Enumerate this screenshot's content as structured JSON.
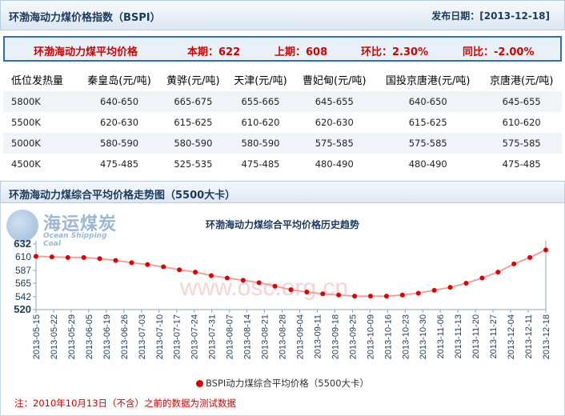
{
  "header": {
    "title": "环渤海动力煤价格指数（BSPI）",
    "date_label": "发布日期：[2013-12-18]"
  },
  "summary": {
    "label": "环渤海动力煤平均价格",
    "current": "本期：622",
    "previous": "上期：608",
    "mom": "环比：2.30%",
    "yoy": "同比：-2.00%"
  },
  "table": {
    "headers": [
      "低位发热量",
      "秦皇岛(元/吨)",
      "黄骅(元/吨)",
      "天津(元/吨)",
      "曹妃甸(元/吨)",
      "国投京唐港(元/吨)",
      "京唐港(元/吨)"
    ],
    "rows": [
      [
        "5800K",
        "640-650",
        "665-675",
        "655-665",
        "645-655",
        "640-650",
        "645-655"
      ],
      [
        "5500K",
        "620-630",
        "615-625",
        "610-620",
        "620-630",
        "615-625",
        "610-620"
      ],
      [
        "5000K",
        "580-590",
        "580-590",
        "580-590",
        "575-585",
        "575-585",
        "575-585"
      ],
      [
        "4500K",
        "475-485",
        "525-535",
        "475-485",
        "480-490",
        "480-490",
        "475-485"
      ]
    ]
  },
  "chart_section": {
    "title": "环渤海动力煤综合平均价格走势图（5500大卡）",
    "logo_cn": "海运煤炭",
    "logo_en": "Ocean Shipping Coal",
    "watermark": "www.osc.org.cn",
    "note": "注：2010年10月13日（不含）之前的数据为测试数据"
  },
  "chart_data": {
    "type": "line",
    "title": "环渤海动力煤综合平均价格历史趋势",
    "series_name": "BSPI动力煤综合平均价格（5500大卡）",
    "x": [
      "2013-05-15",
      "2013-05-22",
      "2013-05-29",
      "2013-06-05",
      "2013-06-12",
      "2013-06-19",
      "2013-06-26",
      "2013-07-03",
      "2013-07-10",
      "2013-07-17",
      "2013-07-24",
      "2013-07-31",
      "2013-08-07",
      "2013-08-14",
      "2013-08-21",
      "2013-08-28",
      "2013-09-04",
      "2013-09-11",
      "2013-09-18",
      "2013-09-25",
      "2013-10-02",
      "2013-10-09",
      "2013-10-16",
      "2013-10-23",
      "2013-10-30",
      "2013-11-06",
      "2013-11-13",
      "2013-11-20",
      "2013-11-27",
      "2013-12-04",
      "2013-12-11",
      "2013-12-18"
    ],
    "x_tick_labels": [
      "2013-05-15",
      "2013-05-22",
      "2013-05-29",
      "2013-06-05",
      "2013-06-19",
      "2013-06-26",
      "2013-07-03",
      "2013-07-10",
      "2013-07-17",
      "2013-07-24",
      "2013-07-31",
      "2013-08-07",
      "2013-08-14",
      "2013-08-21",
      "2013-08-28",
      "2013-09-04",
      "2013-09-11",
      "2013-09-18",
      "2013-09-25",
      "2013-10-09",
      "2013-10-16",
      "2013-10-23",
      "2013-10-30",
      "2013-11-06",
      "2013-11-13",
      "2013-11-20",
      "2013-11-27",
      "2013-12-04",
      "2013-12-11",
      "2013-12-18"
    ],
    "values": [
      611,
      610,
      609,
      609,
      607,
      604,
      600,
      597,
      593,
      588,
      584,
      578,
      574,
      570,
      566,
      560,
      554,
      550,
      547,
      545,
      543,
      543,
      543,
      545,
      548,
      553,
      558,
      565,
      574,
      584,
      598,
      609,
      622
    ],
    "ylim": [
      520,
      632
    ],
    "yticks": [
      520,
      542,
      565,
      587,
      610,
      632
    ],
    "y_bold_ticks": [
      520,
      632
    ],
    "grid": false,
    "colors": {
      "line": "#f1a0a0",
      "marker": "#e00000",
      "axis": "#8aa4bd",
      "label": "#1b3a5c"
    }
  }
}
